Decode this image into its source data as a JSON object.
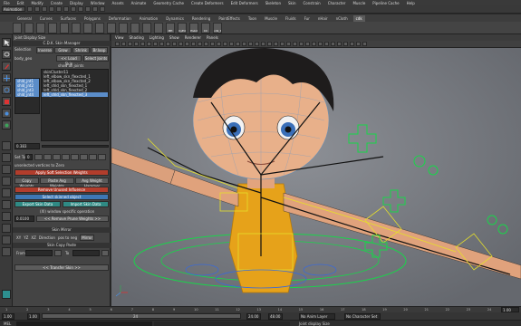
{
  "menubar": {
    "items": [
      "File",
      "Edit",
      "Modify",
      "Create",
      "Display",
      "Window",
      "Assets",
      "Animate",
      "Geometry Cache",
      "Create Deformers",
      "Edit Deformers",
      "Skeleton",
      "Skin",
      "Constrain",
      "Character",
      "Muscle",
      "Pipeline Cache",
      "Help"
    ]
  },
  "modebar": {
    "mode": "Animation"
  },
  "shelf": {
    "tabs": [
      "General",
      "Curves",
      "Surfaces",
      "Polygons",
      "Deformation",
      "Animation",
      "Dynamics",
      "Rendering",
      "PaintEffects",
      "Toon",
      "Muscle",
      "Fluids",
      "Fur",
      "nHair",
      "nCloth",
      "cdk"
    ],
    "active_tab": "cdk",
    "buttons": [
      "",
      "",
      "",
      "",
      "",
      "",
      "",
      "",
      "",
      "",
      "",
      "",
      "",
      "MH",
      "CyEd",
      "Hvbd",
      "CC",
      "cdk_t"
    ]
  },
  "panel": {
    "header": "Joint Display Size",
    "title": "C.D.K. Skin Manager",
    "selection_label": "Selection",
    "sel_buttons": [
      "Grow",
      "Shrink",
      "Br.loop",
      "Inverse"
    ],
    "mesh_label": "body_geo",
    "load_btn": "<< Load Skin",
    "select_joints_btn": "Select Joints",
    "show_all_label": "show all joints",
    "joints": [
      {
        "name": "skinCluster11",
        "sel": false
      },
      {
        "name": "left_elbow_skn_flexcted_1",
        "sel": false
      },
      {
        "name": "left_elbow_skn_flexcted_2",
        "sel": false
      },
      {
        "name": "left_shld_skn_flexcted_1",
        "sel": false
      },
      {
        "name": "left_shld_skn_flexcted_2",
        "sel": false
      },
      {
        "name": "left_shld_skn_flexcted_3",
        "sel": true
      }
    ],
    "joint_side": [
      "shld_jnt1",
      "shld_jnt2",
      "shld_jnt3",
      "shld_jnt4"
    ],
    "weight_value": "0.383",
    "set_to_label": "Set To",
    "set_to_value": "0",
    "unselected_label": "unselected vertices to Zero",
    "apply_btn": "Apply Soft Selection Weights",
    "copy_btn": "Copy Weights",
    "paste_btn": "Paste Avg Weights",
    "avg_btn": "Avg Weight Hammer",
    "remove_unused_btn": "Remove Unused Influence",
    "select_skinned_btn": "Select skinned object",
    "export_btn": "Export Skin Data",
    "import_btn": "Import Skin Data",
    "ops_label": "(Xl) window specific operation",
    "prune_value": "0.0100",
    "prune_btn": "<< Remove Prune Weights >>",
    "mirror_header": "Skin Mirror",
    "mirror_opts": [
      "XY",
      "YZ",
      "XZ",
      "Direction",
      "pos to neg",
      "Mirror"
    ],
    "copypaste_header": "Skin Copy Paste",
    "from_label": "From",
    "to_label": "To",
    "transfer_btn": "<< Transfer Skin >>"
  },
  "viewport": {
    "menus": [
      "View",
      "Shading",
      "Lighting",
      "Show",
      "Renderer",
      "Panels"
    ]
  },
  "timeline": {
    "ticks": [
      "1",
      "2",
      "3",
      "4",
      "5",
      "6",
      "7",
      "8",
      "9",
      "10",
      "11",
      "12",
      "13",
      "14",
      "15",
      "16",
      "17",
      "18",
      "19",
      "20",
      "21",
      "22",
      "23",
      "24"
    ],
    "current_frame": "1.00"
  },
  "range": {
    "start": "1.00",
    "inner_start": "1.00",
    "inner_end_label": "24",
    "end": "24.00",
    "end2": "48.00",
    "anim_layer": "No Anim Layer",
    "char_set": "No Character Set"
  },
  "cmdline": {
    "lang": "MEL",
    "help_text": "Joint display Size"
  },
  "colors": {
    "viewport_bg": "#7e8187",
    "selection_blue": "#5b8dc9",
    "joint_green": "#19d54a",
    "shirt_orange": "#e6a21a"
  }
}
